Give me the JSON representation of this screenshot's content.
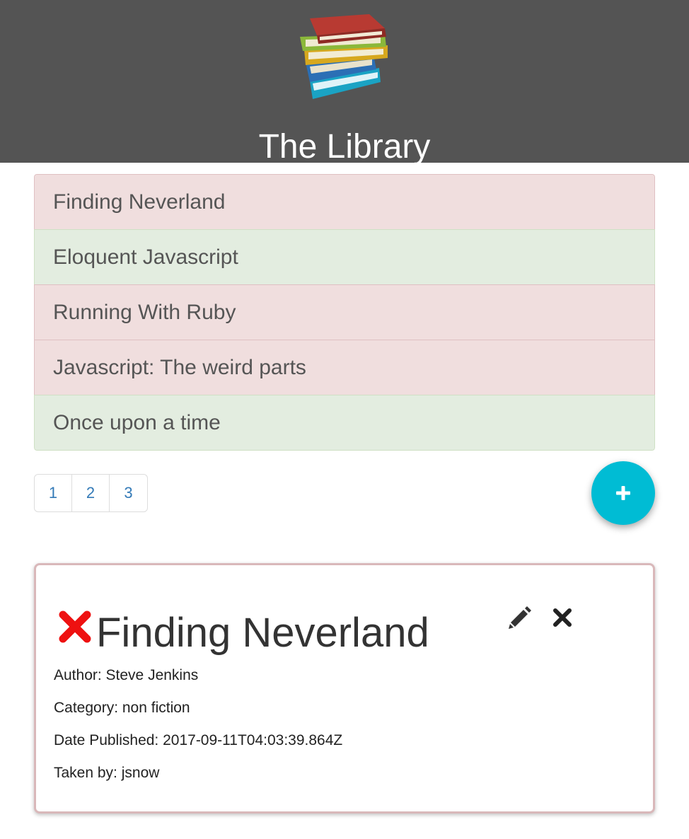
{
  "header": {
    "title": "The Library",
    "logo_icon": "stacked-books-logo",
    "background_color": "#545454"
  },
  "books": [
    {
      "title": "Finding Neverland",
      "status": "taken"
    },
    {
      "title": "Eloquent Javascript",
      "status": "available"
    },
    {
      "title": "Running With Ruby",
      "status": "taken"
    },
    {
      "title": "Javascript: The weird parts",
      "status": "taken"
    },
    {
      "title": "Once upon a time",
      "status": "available"
    }
  ],
  "status_colors": {
    "taken": "#f0dede",
    "available": "#e3ede0"
  },
  "pagination": {
    "pages": [
      "1",
      "2",
      "3"
    ]
  },
  "add_button": {
    "icon": "plus-icon",
    "color": "#00bcd4"
  },
  "detail": {
    "status_icon": "red-x-icon",
    "title": "Finding Neverland",
    "author": "Author: Steve Jenkins",
    "category": "Category: non fiction",
    "date_published": "Date Published: 2017-09-11T04:03:39.864Z",
    "taken_by": "Taken by: jsnow",
    "actions": [
      "pencil-icon",
      "close-icon"
    ]
  }
}
